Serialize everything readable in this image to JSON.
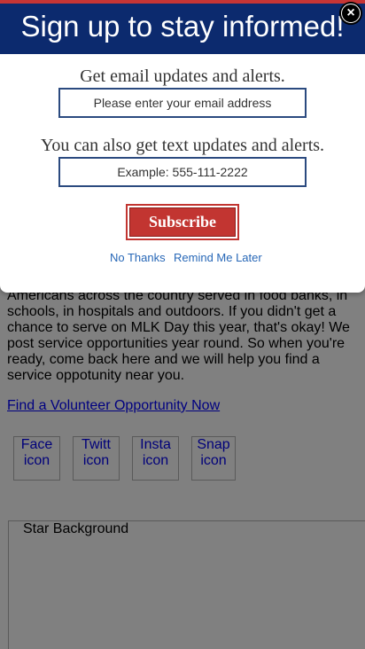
{
  "modal": {
    "title": "Sign up to stay informed!",
    "email_label": "Get email updates and alerts.",
    "email_placeholder": "Please enter your email address",
    "text_label": "You can also get text updates and alerts.",
    "phone_placeholder": "Example: 555-111-2222",
    "subscribe_label": "Subscribe",
    "no_thanks": "No Thanks",
    "remind_later": "Remind Me Later",
    "close_icon": "×"
  },
  "page": {
    "body_text": "Americans across the country served in food banks, in schools, in hospitals and outdoors. If you didn't get a chance to serve on MLK Day this year, that's okay! We post service opportunities year round. So when you're ready, come back here and we will help you find a service oppotunity near you.",
    "volunteer_link": "Find a Volunteer Opportunity Now",
    "social": [
      {
        "line1": "Face",
        "line2": "icon"
      },
      {
        "line1": "Twitt",
        "line2": "icon"
      },
      {
        "line1": "Insta",
        "line2": "icon"
      },
      {
        "line1": "Snap",
        "line2": "icon"
      }
    ],
    "star_background": "Star Background"
  },
  "colors": {
    "header": "#0c2a6e",
    "header_stripe": "#c73535",
    "subscribe": "#c23531",
    "link": "#2767b7",
    "overlay": "#808080"
  }
}
